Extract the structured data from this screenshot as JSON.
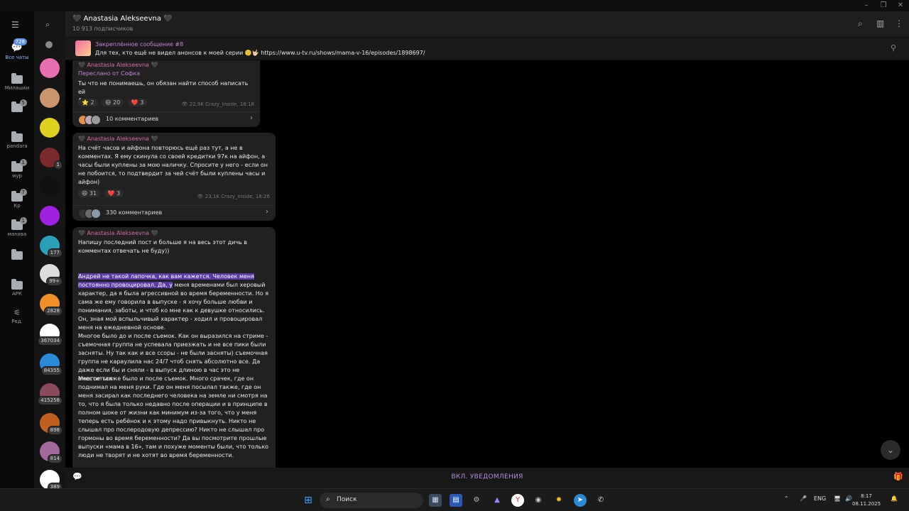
{
  "window": {
    "controls": [
      "–",
      "❐",
      "✕"
    ]
  },
  "folders": [
    {
      "label": "Все чаты",
      "badge": "728",
      "icon": "chat-bubbles-icon"
    },
    {
      "label": "Милашки",
      "badge": "",
      "icon": "folder-icon"
    },
    {
      "label": "",
      "badge": "5",
      "icon": "folder-icon"
    },
    {
      "label": "pandara",
      "badge": "",
      "icon": "folder-icon"
    },
    {
      "label": "мур",
      "badge": "1",
      "icon": "folder-icon"
    },
    {
      "label": "Кр",
      "badge": "7",
      "icon": "folder-icon"
    },
    {
      "label": "манхва",
      "badge": "1",
      "icon": "folder-icon"
    },
    {
      "label": "",
      "badge": "",
      "icon": "folder-icon"
    },
    {
      "label": "АРК",
      "badge": "",
      "icon": "folder-icon"
    },
    {
      "label": "Ред.",
      "badge": "",
      "icon": "edit-sliders-icon"
    }
  ],
  "chatlist": {
    "avatars": [
      {
        "badge": "",
        "color": "#e86fb0"
      },
      {
        "badge": "",
        "color": "#c9956e"
      },
      {
        "badge": "",
        "color": "#e0d020"
      },
      {
        "badge": "1",
        "color": "#7a2a2a"
      },
      {
        "badge": "",
        "color": "#111111"
      },
      {
        "badge": "",
        "color": "#a020e0"
      },
      {
        "badge": "177",
        "color": "#2aa0b8"
      },
      {
        "badge": "99+",
        "color": "#dddddd"
      },
      {
        "badge": "2828",
        "color": "#f0902a"
      },
      {
        "badge": "367034",
        "color": "#ffffff"
      },
      {
        "badge": "84355",
        "color": "#2a8ad8"
      },
      {
        "badge": "415258",
        "color": "#8a4a5a"
      },
      {
        "badge": "898",
        "color": "#c06020"
      },
      {
        "badge": "814",
        "color": "#a06a9a"
      },
      {
        "badge": "389",
        "color": "#ffffff"
      }
    ]
  },
  "header": {
    "title": "🖤 Anastasia Alekseevna 🖤",
    "subscribers": "10 913 подписчиков"
  },
  "pinned": {
    "title": "Закреплённое сообщение #8",
    "text": "Для тех, кто ещё не видел анонсов к моей серии 🙂🤟🏻 https://www.u-tv.ru/shows/mama-v-16/episodes/1898697/"
  },
  "messages": [
    {
      "author": "🖤 Anastasia Alekseevna 🖤",
      "forwarded": "Переслано от Софка",
      "text": "Ты что не понимаешь, он обязан найти способ написать ей\nАхах",
      "reactions": [
        "⭐ 2",
        "😄 20",
        "❤️ 3"
      ],
      "views": "👁 22,9K",
      "meta": "Crazy_Inside, 18:18",
      "comments": "10 комментариев"
    },
    {
      "author": "🖤 Anastasia Alekseevna 🖤",
      "text": "На счёт часов и айфона повторюсь ещё раз тут, а не в комментах. Я ему скинула со своей кредитки 97к на айфон, а часы были куплены за мою наличку. Спросите у него - если он не побоится, то подтвердит за чей счёт были куплены часы и айфон)",
      "reactions": [
        "😄 31",
        "❤️ 3"
      ],
      "views": "👁 23,1K",
      "meta": "Crazy_Inside, 18:26",
      "comments": "330 комментариев"
    },
    {
      "author": "🖤 Anastasia Alekseevna 🖤",
      "intro": "Напишу последний пост и больше я на весь этот дичь в комментах отвечать не буду))",
      "hl1": "Андрей не такой лапочка, как вам кажется. Человек меня",
      "hl2": "постоянно провоцировал. Да, у",
      "rest1": " меня временами был херовый характер, да я была агрессивной во время беременности. Но я сама же ему говорила в выпуске - я хочу больше любви и понимания, заботы, и чтоб ко мне как к девушке относились. Он, зная мой вспыльчивый характер - ходил и провоцировал меня на ежедневной основе.\nМногое было до и после съемок. Как он выразился на стриме - съемочная группа не успевала приезжать и не все пики были засняты. Ну так как и все ссоры - не были засняты) съемочная группа не караулила нас 24/7 чтоб снять абсолютно все. Да даже если бы и сняли - в выпуск длиною в час это не вместиться",
      "rest2": "Многое также было и после съемок. Много срачек, где он поднимал на меня руки. Где он меня посылал также, где он меня засирал как последнего человека на земле ни смотря на то, что я была только недавно после операции и в принципе в полном шоке от жизни как минимум из-за того, что у меня теперь есть ребёнок и к этому надо привыкнуть. Никто не слышал про послеродовую депрессию? Никто не слышал про гормоны во время беременности? Да вы посмотрите прошлые выпуски «мама в 16», там и похуже моменты были, что только люди не творят и не хотят во время беременности."
    }
  ],
  "bottombar": {
    "notify_label": "ВКЛ. УВЕДОМЛЕНИЯ"
  },
  "taskbar": {
    "search_placeholder": "Поиск",
    "lang": "ENG",
    "time": "8:17",
    "date": "08.11.2025"
  }
}
